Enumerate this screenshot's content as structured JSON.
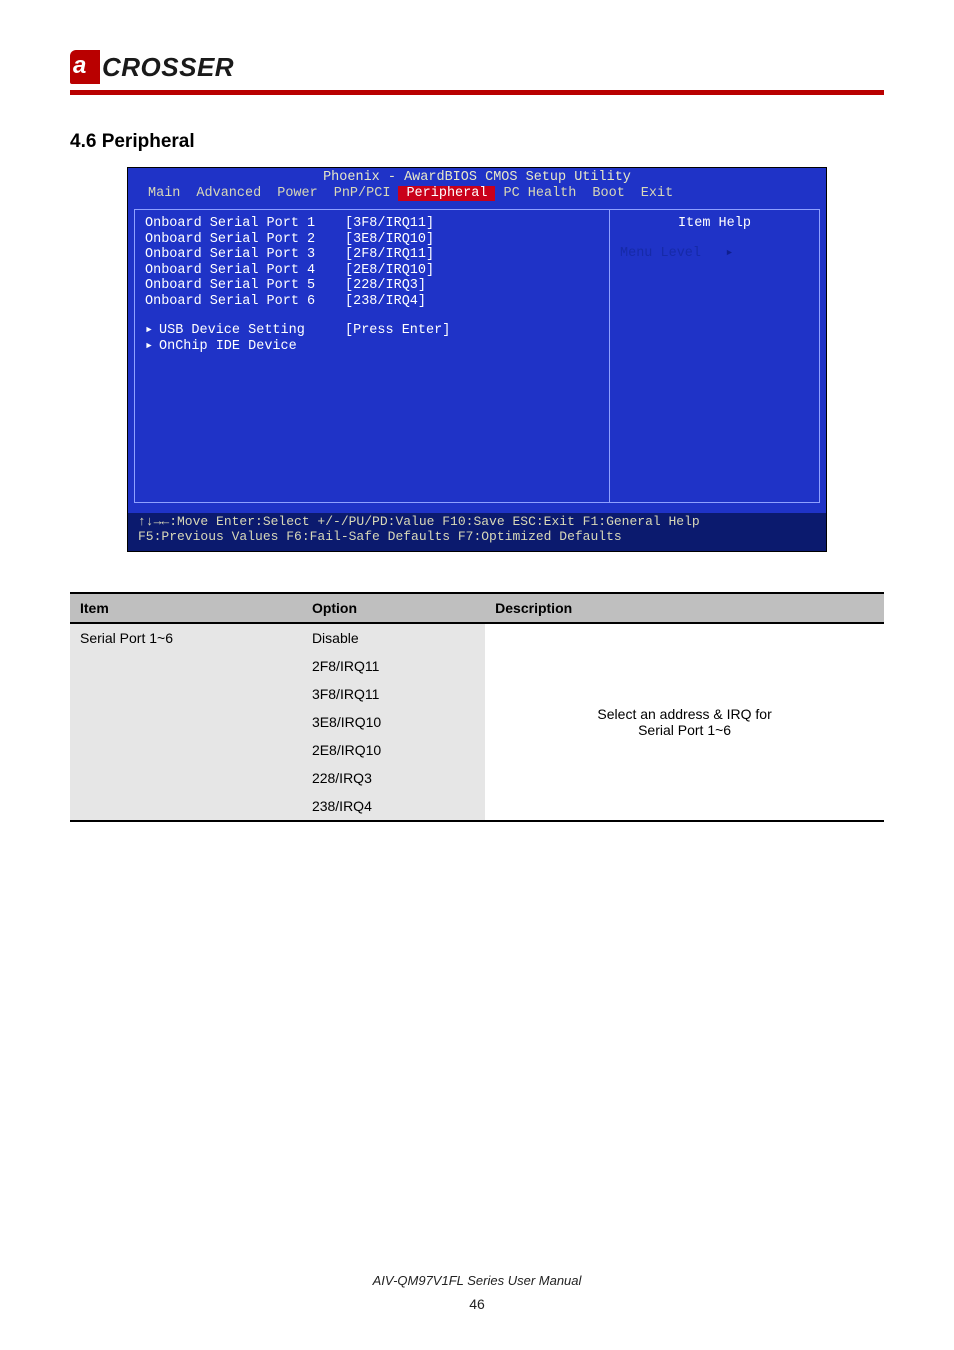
{
  "logo": {
    "a": "a",
    "text": "CROSSER"
  },
  "section_title": "4.6 Peripheral",
  "bios": {
    "title": "Phoenix - AwardBIOS CMOS Setup Utility",
    "menu": [
      "Main",
      "Advanced",
      "Power",
      "PnP/PCI",
      "Peripheral",
      "PC Health",
      "Boot",
      "Exit"
    ],
    "menu_selected_index": 4,
    "rows": [
      {
        "label": "Onboard Serial Port 1",
        "value": "[3F8/IRQ11]",
        "hi": true,
        "lwhite": true
      },
      {
        "label": "Onboard Serial Port 2",
        "value": "[3E8/IRQ10]",
        "lwhite": true
      },
      {
        "label": "Onboard Serial Port 3",
        "value": "[2F8/IRQ11]",
        "lwhite": true
      },
      {
        "label": "Onboard Serial Port 4",
        "value": "[2E8/IRQ10]",
        "lwhite": true
      },
      {
        "label": "Onboard Serial Port 5",
        "value": "[228/IRQ3]",
        "lwhite": true
      },
      {
        "label": "Onboard Serial Port 6",
        "value": "[238/IRQ4]",
        "lwhite": true
      }
    ],
    "subitems": [
      {
        "label": "USB Device Setting",
        "value": "[Press Enter]"
      },
      {
        "label": "OnChip IDE Device",
        "value": ""
      }
    ],
    "help_title": "Item Help",
    "menu_level_label": "Menu Level",
    "footer_line1": "↑↓→←:Move  Enter:Select  +/-/PU/PD:Value  F10:Save  ESC:Exit  F1:General Help",
    "footer_line2": "F5:Previous Values    F6:Fail-Safe Defaults    F7:Optimized Defaults"
  },
  "table": {
    "headers": [
      "Item",
      "Option",
      "Description"
    ],
    "item_label": "Serial Port 1~6",
    "options": [
      "Disable",
      "2F8/IRQ11",
      "3F8/IRQ11",
      "3E8/IRQ10",
      "2E8/IRQ10",
      "228/IRQ3",
      "238/IRQ4"
    ],
    "desc_lines": [
      "Select an address & IRQ for",
      "Serial Port 1~6"
    ]
  },
  "footer": {
    "line": "AIV-QM97V1FL Series User Manual",
    "page": "46"
  }
}
